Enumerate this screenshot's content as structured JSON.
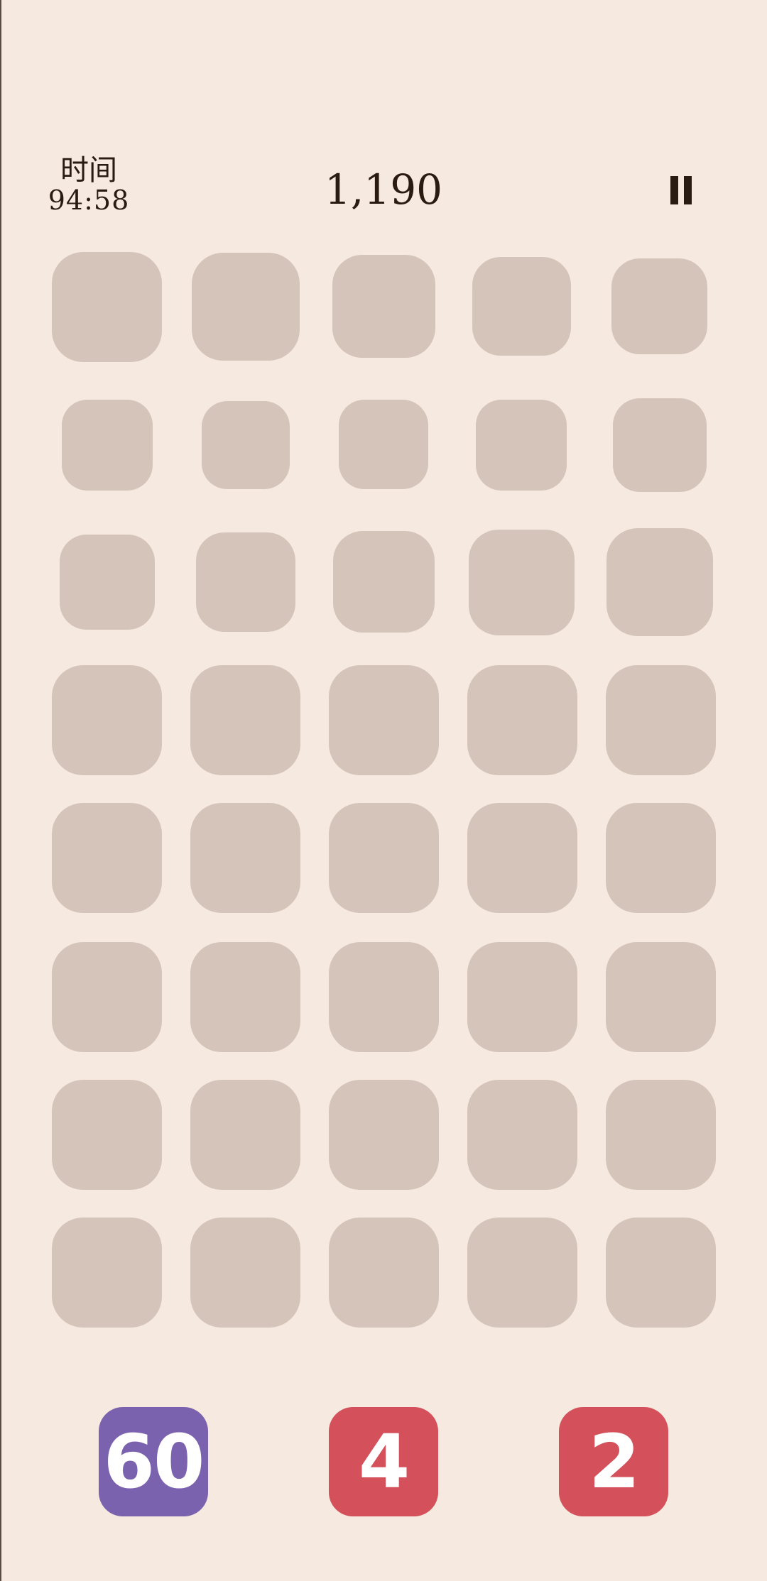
{
  "header": {
    "time_label": "时间",
    "time_value": "94:58",
    "score": "1,190"
  },
  "board": {
    "rows": 8,
    "cols": 5,
    "cell_color": "#d5c4b9",
    "filled_cells": 0
  },
  "next_tiles": [
    {
      "value": "60",
      "color": "#7b62ae"
    },
    {
      "value": "4",
      "color": "#d4505b"
    },
    {
      "value": "2",
      "color": "#d4505b"
    }
  ],
  "colors": {
    "background": "#f6e9df",
    "text": "#2a1b10"
  },
  "icons": {
    "pause": "pause-icon"
  }
}
